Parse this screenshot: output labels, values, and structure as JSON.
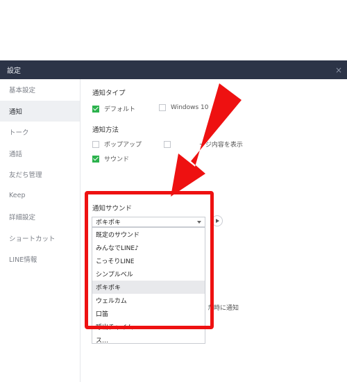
{
  "window": {
    "title": "設定",
    "close_icon": "×"
  },
  "sidebar": {
    "items": [
      {
        "label": "基本設定",
        "active": false
      },
      {
        "label": "通知",
        "active": true
      },
      {
        "label": "トーク",
        "active": false
      },
      {
        "label": "通話",
        "active": false
      },
      {
        "label": "友だち管理",
        "active": false
      },
      {
        "label": "Keep",
        "active": false
      },
      {
        "label": "詳細設定",
        "active": false
      },
      {
        "label": "ショートカット",
        "active": false
      },
      {
        "label": "LINE情報",
        "active": false
      }
    ]
  },
  "main": {
    "notification_type": {
      "title": "通知タイプ",
      "default_label": "デフォルト",
      "default_checked": true,
      "windows_label": "Windows 10",
      "windows_checked": false
    },
    "notification_method": {
      "title": "通知方法",
      "popup_label": "ポップアップ",
      "popup_checked": false,
      "message_label": "ージ内容を表示",
      "message_checked": false,
      "sound_label": "サウンド",
      "sound_checked": true
    },
    "notification_sound": {
      "title": "通知サウンド",
      "selected": "ポキポキ",
      "options": [
        "既定のサウンド",
        "みんなでLINE♪",
        "こっそりLINE",
        "シンプルベル",
        "ポキポキ",
        "ウェルカム",
        "口笛",
        "呼出チャイム",
        "ス…"
      ]
    },
    "behind_text": "た時に通知"
  },
  "colors": {
    "titlebar": "#2c3447",
    "accent_green": "#2bb24c",
    "annotation_red": "#ee1111"
  }
}
